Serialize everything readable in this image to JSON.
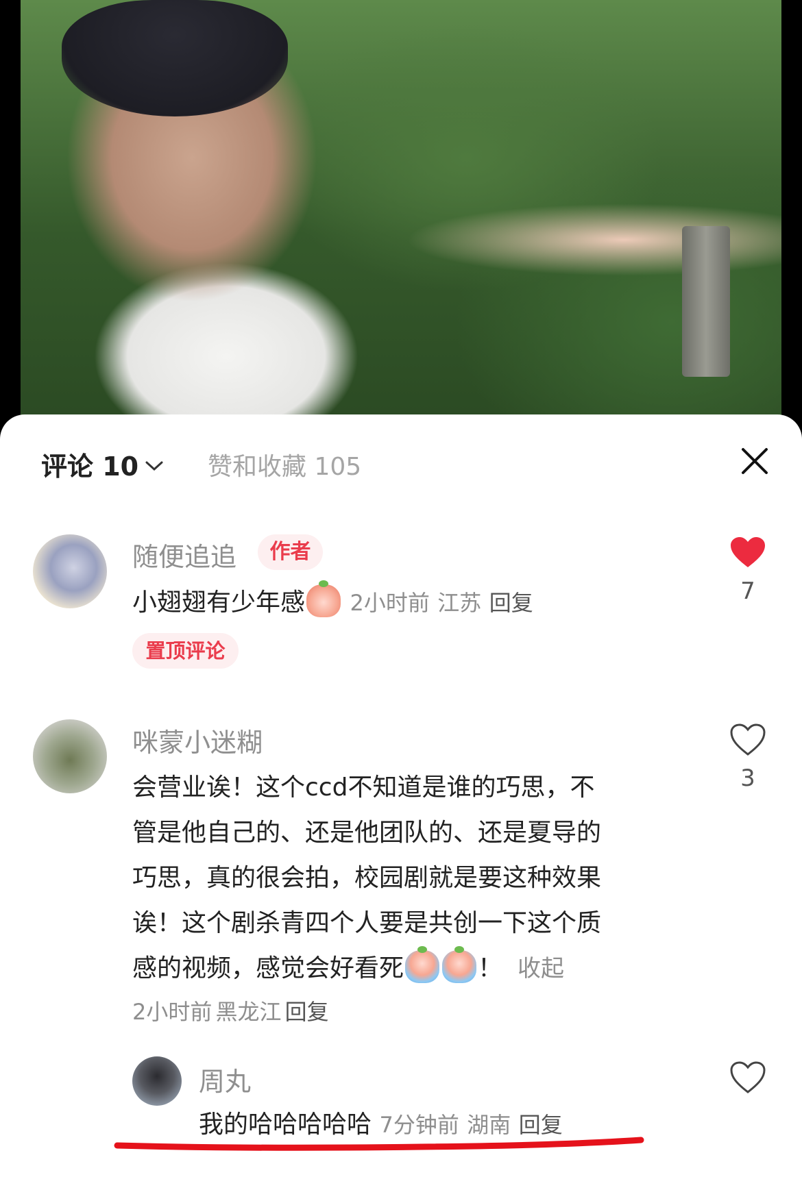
{
  "tabs": {
    "comments_label": "评论 10",
    "likes_label": "赞和收藏 105"
  },
  "comments": [
    {
      "username": "随便追追",
      "badge": "作者",
      "text": "小翅翅有少年感",
      "time": "2小时前",
      "location": "江苏",
      "reply": "回复",
      "pinned": "置顶评论",
      "likes": "7",
      "liked": true
    },
    {
      "username": "咪蒙小迷糊",
      "lines": [
        "会营业诶！这个ccd不知道是谁的巧思，不",
        "管是他自己的、还是他团队的、还是夏导的",
        "巧思，真的很会拍，校园剧就是要这种效果",
        "诶！这个剧杀青四个人要是共创一下这个质",
        "感的视频，感觉会好看死"
      ],
      "after_emoji": "！",
      "collapse": "收起",
      "time": "2小时前",
      "location": "黑龙江",
      "reply": "回复",
      "likes": "3",
      "liked": false,
      "replies": [
        {
          "username": "周丸",
          "text": "我的哈哈哈哈哈",
          "time": "7分钟前",
          "location": "湖南",
          "reply": "回复",
          "liked": false
        }
      ]
    }
  ],
  "icons": {
    "heart_filled_color": "#ec2b3f",
    "underline_color": "#e5121b",
    "badge_text_color": "#ea3c4c"
  }
}
